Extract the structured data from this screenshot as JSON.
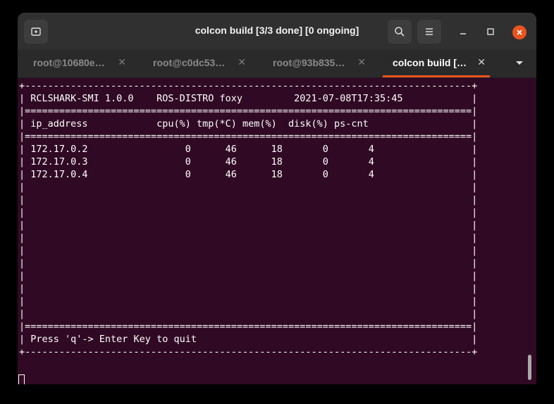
{
  "window": {
    "title": "colcon build [3/3 done] [0 ongoing]",
    "close_color": "#e95420"
  },
  "tabs": [
    {
      "label": "root@10680e…",
      "close": "✕",
      "active": false
    },
    {
      "label": "root@c0dc53…",
      "close": "✕",
      "active": false
    },
    {
      "label": "root@93b835…",
      "close": "✕",
      "active": false
    },
    {
      "label": "colcon build […",
      "close": "✕",
      "active": true
    }
  ],
  "terminal": {
    "bg_color": "#300a24",
    "header": {
      "app": "RCLSHARK-SMI 1.0.0",
      "distro": "ROS-DISTRO foxy",
      "datetime": "2021-07-08T17:35:45"
    },
    "columns": [
      "ip_address",
      "cpu(%)",
      "tmp(*C)",
      "mem(%)",
      "disk(%)",
      "ps-cnt"
    ],
    "rows": [
      {
        "ip": "172.17.0.2",
        "cpu": "0",
        "tmp": "46",
        "mem": "18",
        "disk": "0",
        "ps": "4"
      },
      {
        "ip": "172.17.0.3",
        "cpu": "0",
        "tmp": "46",
        "mem": "18",
        "disk": "0",
        "ps": "4"
      },
      {
        "ip": "172.17.0.4",
        "cpu": "0",
        "tmp": "46",
        "mem": "18",
        "disk": "0",
        "ps": "4"
      }
    ],
    "footer": "Press 'q'-> Enter Key to quit"
  }
}
